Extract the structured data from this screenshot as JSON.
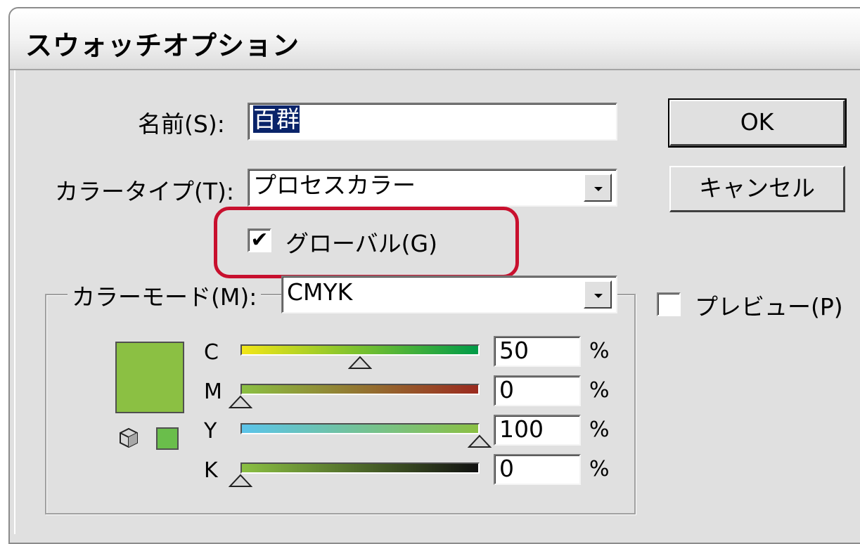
{
  "window": {
    "title": "スウォッチオプション"
  },
  "name_field": {
    "label": "名前(S):",
    "value": "百群"
  },
  "color_type": {
    "label": "カラータイプ(T):",
    "value": "プロセスカラー"
  },
  "global": {
    "label": "グローバル(G)",
    "checked": true,
    "highlight_color": "#c8102e"
  },
  "color_mode": {
    "label": "カラーモード(M):",
    "value": "CMYK"
  },
  "buttons": {
    "ok": "OK",
    "cancel": "キャンセル"
  },
  "preview": {
    "label": "プレビュー(P)",
    "checked": false
  },
  "swatch": {
    "color": "#8bc043",
    "small_color": "#6abe4b"
  },
  "sliders": [
    {
      "channel": "C",
      "value": "50",
      "unit": "%",
      "fraction": 0.5,
      "gradient": [
        "#f2e618",
        "#009b48"
      ]
    },
    {
      "channel": "M",
      "value": "0",
      "unit": "%",
      "fraction": 0.0,
      "gradient": [
        "#8bc043",
        "#9b2a1f"
      ]
    },
    {
      "channel": "Y",
      "value": "100",
      "unit": "%",
      "fraction": 1.0,
      "gradient": [
        "#5bc4ea",
        "#8bc043"
      ]
    },
    {
      "channel": "K",
      "value": "0",
      "unit": "%",
      "fraction": 0.0,
      "gradient": [
        "#8bc043",
        "#111111"
      ]
    }
  ]
}
